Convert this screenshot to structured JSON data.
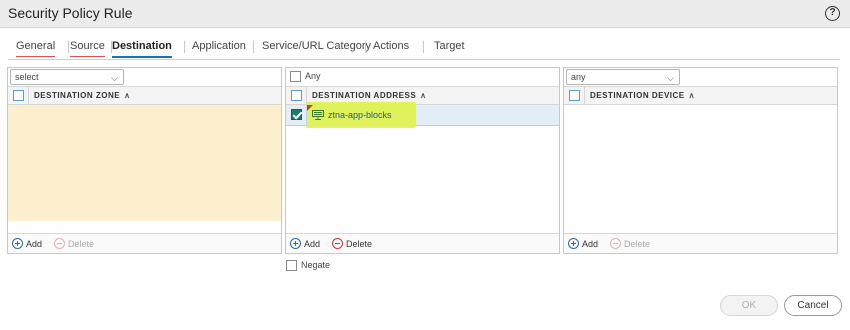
{
  "window": {
    "title": "Security Policy Rule",
    "help_icon": "help-circle-icon"
  },
  "tabs": [
    {
      "label": "General"
    },
    {
      "label": "Source"
    },
    {
      "label": "Destination"
    },
    {
      "label": "Application"
    },
    {
      "label": "Service/URL Category"
    },
    {
      "label": "Actions"
    },
    {
      "label": "Target"
    }
  ],
  "destination_zone": {
    "dropdown_value": "select",
    "header": "DESTINATION ZONE",
    "add_label": "Add",
    "delete_label": "Delete"
  },
  "destination_address": {
    "any_label": "Any",
    "header": "DESTINATION ADDRESS",
    "rows": [
      {
        "value": "ztna-app-blocks",
        "checked": true
      }
    ],
    "add_label": "Add",
    "delete_label": "Delete",
    "negate_label": "Negate"
  },
  "destination_device": {
    "dropdown_value": "any",
    "header": "DESTINATION DEVICE",
    "add_label": "Add",
    "delete_label": "Delete"
  },
  "buttons": {
    "ok": "OK",
    "cancel": "Cancel"
  },
  "colors": {
    "zone_body": "#fdf0cf",
    "highlight": "#dff24a",
    "active_tab": "#1a73b8",
    "checked": "#1d7a6e"
  }
}
